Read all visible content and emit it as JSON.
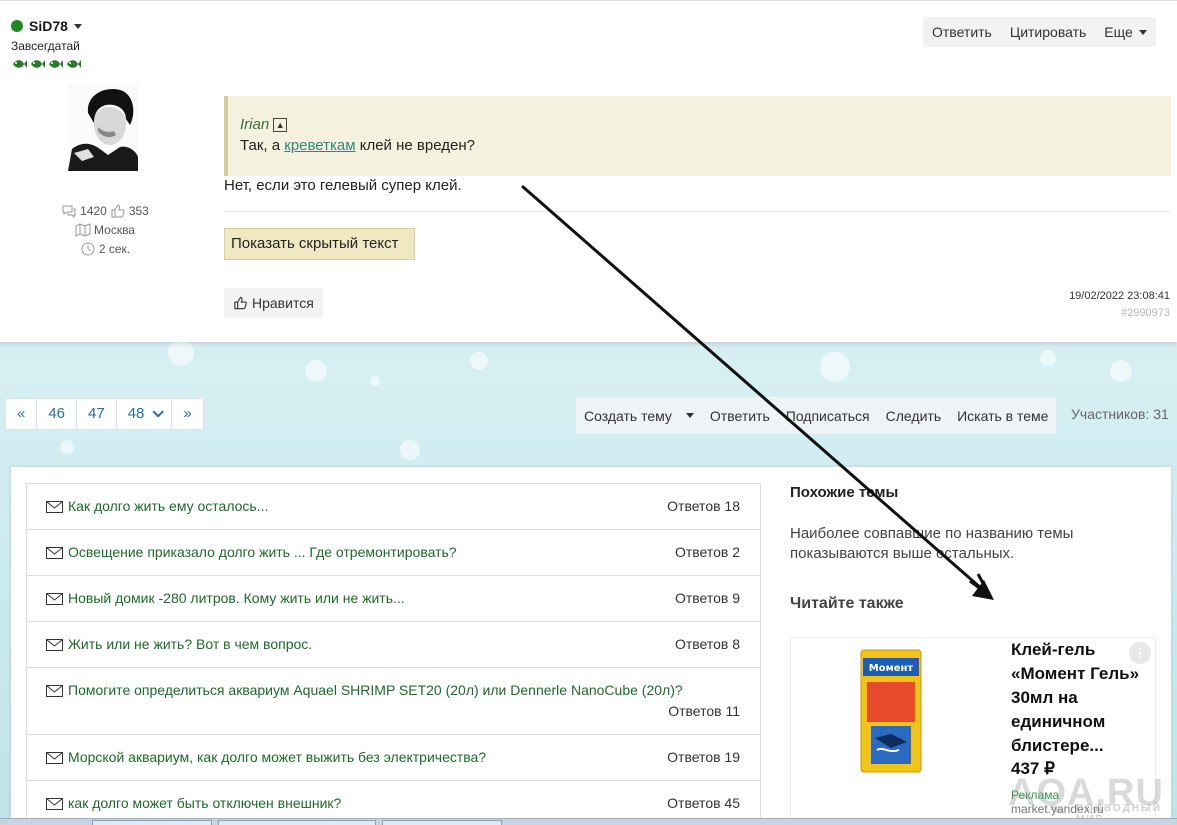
{
  "post": {
    "author": {
      "name": "SiD78",
      "rank": "Завсегдатай",
      "posts_count": "1420",
      "likes_count": "353",
      "city": "Москва",
      "last_seen": "2 сек."
    },
    "actions": {
      "reply": "Ответить",
      "quote": "Цитировать",
      "more": "Еще"
    },
    "quote": {
      "author": "Irian",
      "text_before": "Так, а ",
      "link_text": "креветкам",
      "text_after": " клей не вреден?"
    },
    "reply_text": "Нет, если это гелевый супер клей.",
    "show_hidden_button": "Показать скрытый текст",
    "like_button": "Нравится",
    "date": "19/02/2022 23:08:41",
    "post_id": "#2990973"
  },
  "pagination": {
    "prev": "«",
    "pages": [
      "46",
      "47",
      "48"
    ],
    "next": "»"
  },
  "toolbar": {
    "create_topic": "Создать тему",
    "reply": "Ответить",
    "subscribe": "Подписаться",
    "follow": "Следить",
    "search": "Искать в теме",
    "participants": "Участников: 31"
  },
  "topics": [
    {
      "title": "Как долго жить ему осталось...",
      "replies": "Ответов 18"
    },
    {
      "title": "Освещение приказало долго жить ... Где отремонтировать?",
      "replies": "Ответов 2"
    },
    {
      "title": "Новый домик -280 литров. Кому жить или не жить...",
      "replies": "Ответов 9"
    },
    {
      "title": "Жить или не жить? Вот в чем вопрос.",
      "replies": "Ответов 8"
    },
    {
      "title": "Помогите определиться аквариум Aquael SHRIMP SET20 (20л) или Dennerle NanoCube (20л)?",
      "replies": "Ответов 11"
    },
    {
      "title": "Морской аквариум, как долго может выжить без электричества?",
      "replies": "Ответов 19"
    },
    {
      "title": "как долго может быть отключен внешник?",
      "replies": "Ответов 45"
    }
  ],
  "sidebar": {
    "similar_heading": "Похожие темы",
    "similar_text": "Наиболее совпавшие по названию темы показываются выше остальных.",
    "read_also": "Читайте также"
  },
  "ad": {
    "title": "Клей-гель «Момент Гель» 30мл на единичном блистере...",
    "price": "437 ₽",
    "label": "Реклама",
    "source": "market.yandex.ru",
    "product_brand": "Момент"
  },
  "watermark": {
    "main": "AQA.RU",
    "sub": "ПОДВОДНЫЙ МИР"
  },
  "colors": {
    "accent_green": "#1d8a1d",
    "link_teal": "#2a8a7a",
    "topic_link": "#1f6a2b",
    "page_link": "#2a6e9a",
    "quote_bg": "#f4f1df"
  }
}
